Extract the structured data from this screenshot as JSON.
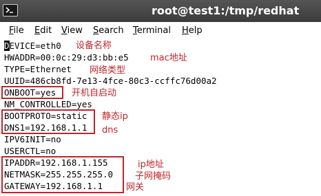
{
  "window": {
    "title": "root@test1:/tmp/redhat"
  },
  "menu": [
    {
      "mnemonic": "F",
      "rest": "ile"
    },
    {
      "mnemonic": "E",
      "rest": "dit"
    },
    {
      "mnemonic": "V",
      "rest": "iew"
    },
    {
      "mnemonic": "S",
      "rest": "earch"
    },
    {
      "mnemonic": "T",
      "rest": "erminal"
    },
    {
      "mnemonic": "H",
      "rest": "elp"
    }
  ],
  "terminal": {
    "lines": [
      {
        "cursor_char": "D",
        "text": "EVICE=eth0"
      },
      {
        "text": "HWADDR=00:0c:29:d3:bb:e5"
      },
      {
        "text": "TYPE=Ethernet"
      },
      {
        "text": "UUID=486cb8fd-7e13-4fce-80c3-ccffc76d00a2"
      },
      {
        "text": "ONBOOT=yes"
      },
      {
        "text": "NM_CONTROLLED=yes"
      },
      {
        "text": "BOOTPROTO=static"
      },
      {
        "text": "DNS1=192.168.1.1"
      },
      {
        "text": "IPV6INIT=no"
      },
      {
        "text": "USERCTL=no"
      },
      {
        "text": "IPADDR=192.168.1.155"
      },
      {
        "text": "NETMASK=255.255.255.0"
      },
      {
        "text": "GATEWAY=192.168.1.1"
      }
    ]
  },
  "annotations": {
    "device_name": "设备名称",
    "mac_address": "mac地址",
    "network_type": "网络类型",
    "boot_start": "开机自启动",
    "static_ip": "静态ip",
    "dns": "dns",
    "ip_address": "ip地址",
    "subnet_mask": "子网掩码",
    "gateway": "网关"
  },
  "colors": {
    "annotation_red": "#c0242a",
    "titlebar": "#3b3b3b"
  },
  "icons": {
    "terminal": "terminal-icon"
  }
}
